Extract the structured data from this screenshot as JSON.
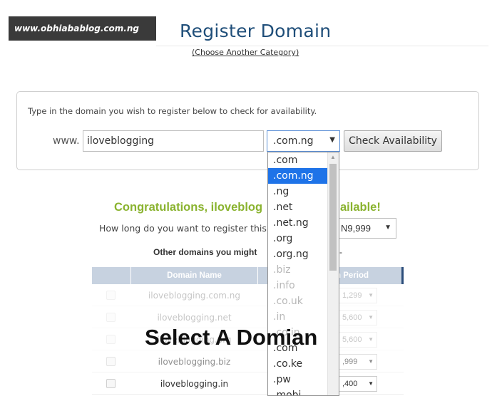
{
  "watermark": "www.obhiabablog.com.ng",
  "header": {
    "title": "Register Domain",
    "link": "(Choose Another Category)"
  },
  "search": {
    "instruction": "Type in the domain you wish to register below to check for availability.",
    "prefix": "www.",
    "domain_value": "iloveblogging",
    "tld_value": ".com.ng",
    "button": "Check Availability"
  },
  "result": {
    "congrats_a": "Congratulations, iloveblog",
    "congrats_b": "ailable!",
    "how_long": "How long do you want to register this fo",
    "period_value": "N9,999",
    "other_domains": "Other domains you might",
    "other_tail": "-"
  },
  "table": {
    "headers": [
      "Domain Name",
      "n Period"
    ],
    "rows": [
      {
        "name": "iloveblogging.com.ng",
        "period": "1,299"
      },
      {
        "name": "iloveblogging.net",
        "period": "5,600"
      },
      {
        "name": "iloveblogging.org",
        "period": "5,600"
      },
      {
        "name": "iloveblogging.biz",
        "period": ",999"
      },
      {
        "name": "iloveblogging.in",
        "period": ",400"
      }
    ]
  },
  "dropdown": {
    "options": [
      ".com",
      ".com.ng",
      ".ng",
      ".net",
      ".net.ng",
      ".org",
      ".org.ng",
      ".biz",
      ".info",
      ".co.uk",
      ".in",
      ".co.in",
      ".com",
      ".co.ke",
      ".pw",
      ".mobi"
    ],
    "selected_index": 1
  },
  "caption": "Select A Domian"
}
